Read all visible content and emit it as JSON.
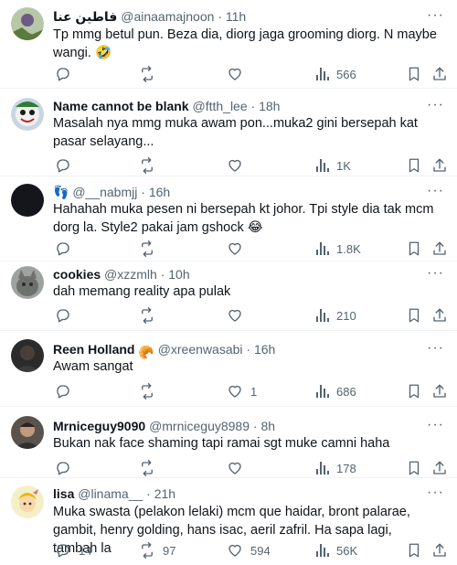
{
  "tweets": [
    {
      "name": "فاطين عنا",
      "handle": "@ainaamajnoon",
      "time": "11h",
      "text": "Tp mmg betul pun. Beza dia, diorg jaga grooming diorg. N maybe wangi. 🤣",
      "text2": "🤣",
      "replies": "",
      "retweets": "",
      "likes": "",
      "views": "566"
    },
    {
      "name": "Name cannot be blank",
      "handle": "@ftth_lee",
      "time": "18h",
      "text": "Masalah nya mmg muka awam pon...muka2 gini bersepah kat pasar selayang...",
      "replies": "",
      "retweets": "",
      "likes": "",
      "views": "1K"
    },
    {
      "name": "👣",
      "handle": "@__nabmjj",
      "time": "16h",
      "text": "Hahahah muka pesen ni bersepah kt johor. Tpi style dia tak mcm dorg la. Style2 pakai jam gshock 😂",
      "replies": "",
      "retweets": "",
      "likes": "",
      "views": "1.8K"
    },
    {
      "name": "cookies",
      "handle": "@xzzmlh",
      "time": "10h",
      "text": "dah memang reality apa pulak",
      "replies": "",
      "retweets": "",
      "likes": "",
      "views": "210"
    },
    {
      "name": "Reen Holland",
      "name_emoji": "🥐",
      "handle": "@xreenwasabi",
      "time": "16h",
      "text": "Awam sangat",
      "replies": "",
      "retweets": "",
      "likes": "1",
      "views": "686"
    },
    {
      "name": "Mrniceguy9090",
      "handle": "@mrniceguy8989",
      "time": "8h",
      "text": "Bukan nak face shaming tapi ramai sgt muke camni haha",
      "replies": "",
      "retweets": "",
      "likes": "",
      "views": "178"
    },
    {
      "name": "lisa",
      "handle": "@linama__",
      "time": "21h",
      "text": "Muka swasta (pelakon lelaki) mcm que haidar, bront palarae, gambit, henry golding, hans isac, aeril zafril. Ha sapa lagi, tambah la",
      "replies": "14",
      "retweets": "97",
      "likes": "594",
      "views": "56K"
    }
  ],
  "separator_dot": "·",
  "more_glyph": "···",
  "icons": [
    "reply-icon",
    "retweet-icon",
    "like-icon",
    "views-icon",
    "bookmark-icon",
    "share-icon",
    "more-icon"
  ],
  "colors": {
    "text": "#0f1419",
    "muted": "#536471",
    "divider": "#eff3f4"
  }
}
